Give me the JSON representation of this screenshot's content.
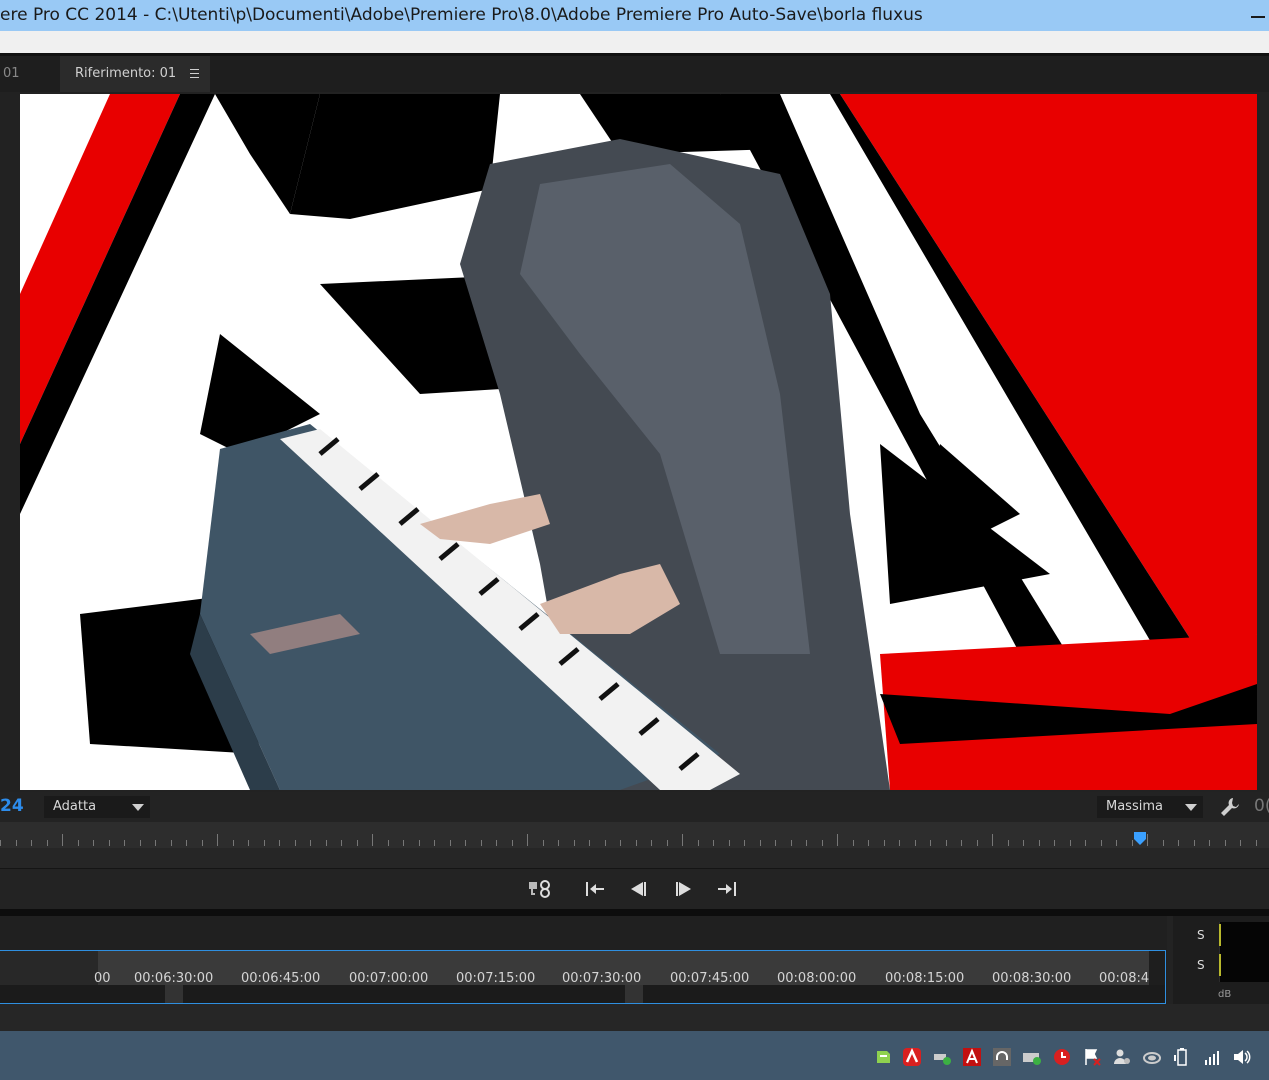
{
  "window": {
    "title": "ere Pro CC 2014 - C:\\Utenti\\p\\Documenti\\Adobe\\Premiere Pro\\8.0\\Adobe Premiere Pro Auto-Save\\borla fluxus"
  },
  "tabs": {
    "left_fragment": "01",
    "active_label": "Riferimento: 01"
  },
  "monitor": {
    "timecode_left": "24",
    "zoom_value": "Adatta",
    "quality_value": "Massima",
    "timecode_right": "0("
  },
  "playhead": {
    "position_fraction": 0.898
  },
  "transport": {
    "buttons": [
      "bind-sequence-icon",
      "go-to-in-icon",
      "step-back-icon",
      "step-forward-icon",
      "go-to-out-icon"
    ]
  },
  "timeline": {
    "labels": [
      "00",
      "00:06:30:00",
      "00:06:45:00",
      "00:07:00:00",
      "00:07:15:00",
      "00:07:30:00",
      "00:07:45:00",
      "00:08:00:00",
      "00:08:15:00",
      "00:08:30:00",
      "00:08:4"
    ]
  },
  "audio_meter": {
    "solo_1": "S",
    "solo_2": "S",
    "unit": "dB"
  },
  "colors": {
    "accent_blue": "#2d8ceb",
    "title_bar": "#99c9f5",
    "taskbar": "#40576c"
  }
}
